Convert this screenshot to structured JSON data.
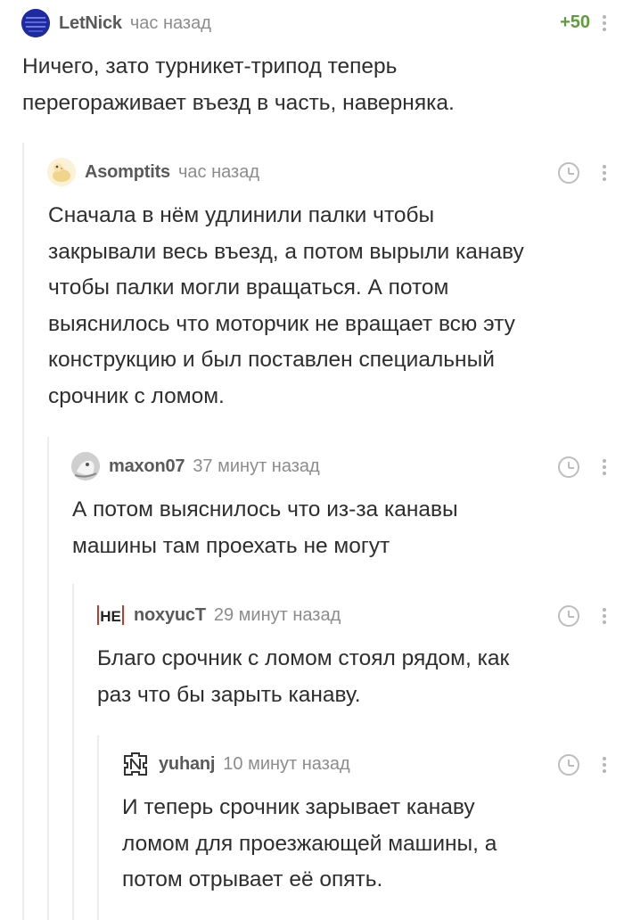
{
  "comments": [
    {
      "author": "LetNick",
      "time": "час назад",
      "rating": "+50",
      "avatar_icon": "pixel-avatar-icon",
      "text": "Ничего, зато турникет-трипод теперь\nперегораживает въезд в часть, наверняка."
    },
    {
      "author": "Asomptits",
      "time": "час назад",
      "avatar_icon": "bird-avatar-icon",
      "text": "Сначала в нём удлинили палки чтобы\nзакрывали весь въезд, а потом вырыли канаву\nчтобы палки могли вращаться. А потом\nвыяснилось что моторчик не вращает всю эту\nконструкцию и был поставлен специальный\nсрочник с ломом."
    },
    {
      "author": "maxon07",
      "time": "37 минут назад",
      "avatar_icon": "photo-avatar-icon",
      "text": "А потом выяснилось что из-за канавы\nмашины там проехать не могут"
    },
    {
      "author": "noxyucT",
      "time": "29 минут назад",
      "avatar_icon": "ne-logo-avatar-icon",
      "avatar_label": "НЕ",
      "text": "Благо срочник с ломом стоял рядом, как\nраз что бы зарыть канаву."
    },
    {
      "author": "yuhanj",
      "time": "10 минут назад",
      "avatar_icon": "band-logo-avatar-icon",
      "text": "И теперь срочник зарывает канаву\nломом для проезжающей машины, а\nпотом отрывает её опять."
    }
  ],
  "colors": {
    "rating": "#5e9e3a",
    "thread_line": "#ececec",
    "author": "#5a5a5a",
    "time": "#8c8c8c"
  }
}
